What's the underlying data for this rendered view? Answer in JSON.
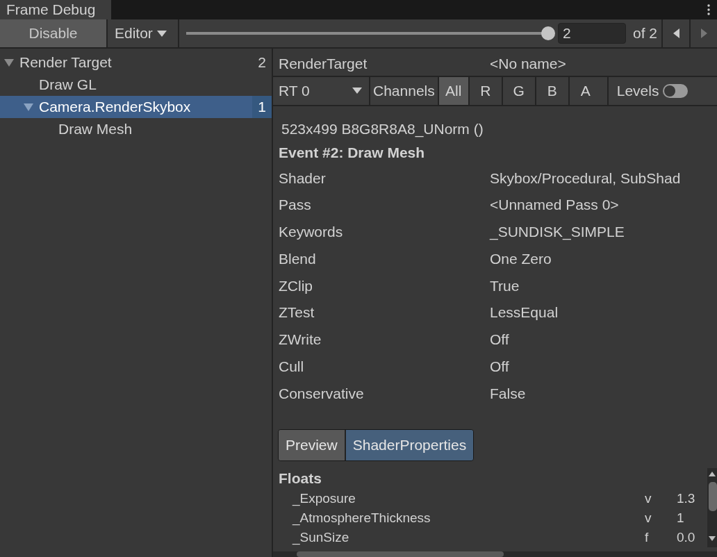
{
  "window": {
    "title": "Frame Debug"
  },
  "toolbar": {
    "disable_button": "Disable",
    "editor_dropdown": "Editor",
    "event_slider": {
      "level": 1.0
    },
    "event_field": {
      "value": "2"
    },
    "event_total": "of 2"
  },
  "tree": [
    {
      "label": "Render Target",
      "count": "2",
      "expanded": true,
      "selected": false,
      "children": [
        {
          "label": "Draw GL",
          "selected": false
        },
        {
          "label": "Camera.RenderSkybox",
          "count": "1",
          "expanded": true,
          "selected": true,
          "children": [
            {
              "label": "Draw Mesh",
              "selected": false
            }
          ]
        }
      ]
    }
  ],
  "render_target": {
    "label": "RenderTarget",
    "value": "<No name>"
  },
  "channels_bar": {
    "rt_dropdown": "RT 0",
    "channels_label": "Channels",
    "channels": [
      {
        "label": "All",
        "selected": true
      },
      {
        "label": "R",
        "selected": false
      },
      {
        "label": "G",
        "selected": false
      },
      {
        "label": "B",
        "selected": false
      },
      {
        "label": "A",
        "selected": false
      }
    ],
    "levels": {
      "label": "Levels",
      "on": false
    }
  },
  "format": "523x499 B8G8R8A8_UNorm ()",
  "event_title": "Event #2: Draw Mesh",
  "properties": [
    {
      "label": "Shader",
      "value": "Skybox/Procedural, SubShad"
    },
    {
      "label": "Pass",
      "value": "<Unnamed Pass 0>"
    },
    {
      "label": "Keywords",
      "value": "_SUNDISK_SIMPLE"
    },
    {
      "label": "Blend",
      "value": "One Zero"
    },
    {
      "label": "ZClip",
      "value": "True"
    },
    {
      "label": "ZTest",
      "value": "LessEqual"
    },
    {
      "label": "ZWrite",
      "value": "Off"
    },
    {
      "label": "Cull",
      "value": "Off"
    },
    {
      "label": "Conservative",
      "value": "False"
    }
  ],
  "tabs": [
    {
      "label": "Preview",
      "selected": false
    },
    {
      "label": "ShaderProperties",
      "selected": true
    }
  ],
  "floats": {
    "title": "Floats",
    "rows": [
      {
        "name": "_Exposure",
        "type": "v",
        "value": "1.3"
      },
      {
        "name": "_AtmosphereThickness",
        "type": "v",
        "value": "1"
      },
      {
        "name": "_SunSize",
        "type": "f",
        "value": "0.0"
      }
    ]
  }
}
